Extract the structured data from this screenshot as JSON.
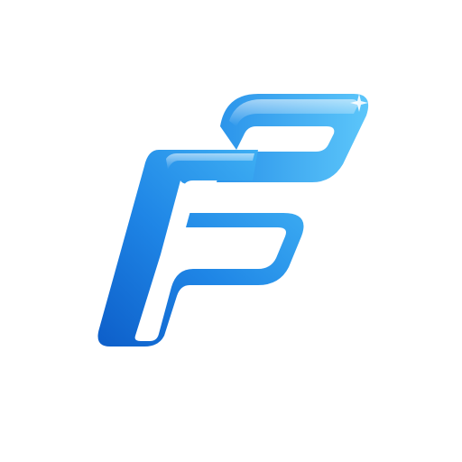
{
  "logo": {
    "icon": "stylized-letter-f-p-monogram",
    "colors": {
      "background": "#ffffff",
      "primary": "#1a7fe0",
      "dark": "#0d5ec9",
      "light": "#3fb3f5",
      "highlight": "#8fd8ff"
    }
  }
}
